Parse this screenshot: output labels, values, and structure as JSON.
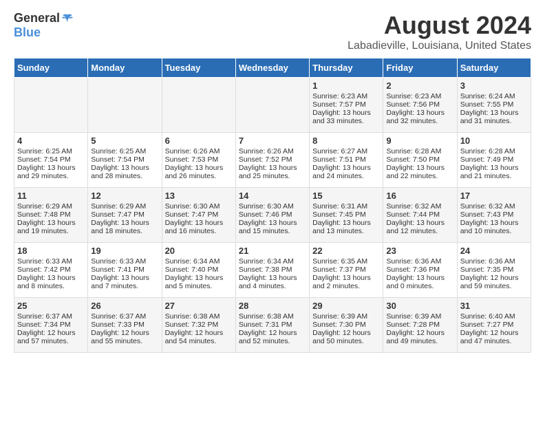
{
  "logo": {
    "general": "General",
    "blue": "Blue"
  },
  "title": "August 2024",
  "subtitle": "Labadieville, Louisiana, United States",
  "headers": [
    "Sunday",
    "Monday",
    "Tuesday",
    "Wednesday",
    "Thursday",
    "Friday",
    "Saturday"
  ],
  "weeks": [
    [
      {
        "day": "",
        "content": ""
      },
      {
        "day": "",
        "content": ""
      },
      {
        "day": "",
        "content": ""
      },
      {
        "day": "",
        "content": ""
      },
      {
        "day": "1",
        "content": "Sunrise: 6:23 AM\nSunset: 7:57 PM\nDaylight: 13 hours and 33 minutes."
      },
      {
        "day": "2",
        "content": "Sunrise: 6:23 AM\nSunset: 7:56 PM\nDaylight: 13 hours and 32 minutes."
      },
      {
        "day": "3",
        "content": "Sunrise: 6:24 AM\nSunset: 7:55 PM\nDaylight: 13 hours and 31 minutes."
      }
    ],
    [
      {
        "day": "4",
        "content": "Sunrise: 6:25 AM\nSunset: 7:54 PM\nDaylight: 13 hours and 29 minutes."
      },
      {
        "day": "5",
        "content": "Sunrise: 6:25 AM\nSunset: 7:54 PM\nDaylight: 13 hours and 28 minutes."
      },
      {
        "day": "6",
        "content": "Sunrise: 6:26 AM\nSunset: 7:53 PM\nDaylight: 13 hours and 26 minutes."
      },
      {
        "day": "7",
        "content": "Sunrise: 6:26 AM\nSunset: 7:52 PM\nDaylight: 13 hours and 25 minutes."
      },
      {
        "day": "8",
        "content": "Sunrise: 6:27 AM\nSunset: 7:51 PM\nDaylight: 13 hours and 24 minutes."
      },
      {
        "day": "9",
        "content": "Sunrise: 6:28 AM\nSunset: 7:50 PM\nDaylight: 13 hours and 22 minutes."
      },
      {
        "day": "10",
        "content": "Sunrise: 6:28 AM\nSunset: 7:49 PM\nDaylight: 13 hours and 21 minutes."
      }
    ],
    [
      {
        "day": "11",
        "content": "Sunrise: 6:29 AM\nSunset: 7:48 PM\nDaylight: 13 hours and 19 minutes."
      },
      {
        "day": "12",
        "content": "Sunrise: 6:29 AM\nSunset: 7:47 PM\nDaylight: 13 hours and 18 minutes."
      },
      {
        "day": "13",
        "content": "Sunrise: 6:30 AM\nSunset: 7:47 PM\nDaylight: 13 hours and 16 minutes."
      },
      {
        "day": "14",
        "content": "Sunrise: 6:30 AM\nSunset: 7:46 PM\nDaylight: 13 hours and 15 minutes."
      },
      {
        "day": "15",
        "content": "Sunrise: 6:31 AM\nSunset: 7:45 PM\nDaylight: 13 hours and 13 minutes."
      },
      {
        "day": "16",
        "content": "Sunrise: 6:32 AM\nSunset: 7:44 PM\nDaylight: 13 hours and 12 minutes."
      },
      {
        "day": "17",
        "content": "Sunrise: 6:32 AM\nSunset: 7:43 PM\nDaylight: 13 hours and 10 minutes."
      }
    ],
    [
      {
        "day": "18",
        "content": "Sunrise: 6:33 AM\nSunset: 7:42 PM\nDaylight: 13 hours and 8 minutes."
      },
      {
        "day": "19",
        "content": "Sunrise: 6:33 AM\nSunset: 7:41 PM\nDaylight: 13 hours and 7 minutes."
      },
      {
        "day": "20",
        "content": "Sunrise: 6:34 AM\nSunset: 7:40 PM\nDaylight: 13 hours and 5 minutes."
      },
      {
        "day": "21",
        "content": "Sunrise: 6:34 AM\nSunset: 7:38 PM\nDaylight: 13 hours and 4 minutes."
      },
      {
        "day": "22",
        "content": "Sunrise: 6:35 AM\nSunset: 7:37 PM\nDaylight: 13 hours and 2 minutes."
      },
      {
        "day": "23",
        "content": "Sunrise: 6:36 AM\nSunset: 7:36 PM\nDaylight: 13 hours and 0 minutes."
      },
      {
        "day": "24",
        "content": "Sunrise: 6:36 AM\nSunset: 7:35 PM\nDaylight: 12 hours and 59 minutes."
      }
    ],
    [
      {
        "day": "25",
        "content": "Sunrise: 6:37 AM\nSunset: 7:34 PM\nDaylight: 12 hours and 57 minutes."
      },
      {
        "day": "26",
        "content": "Sunrise: 6:37 AM\nSunset: 7:33 PM\nDaylight: 12 hours and 55 minutes."
      },
      {
        "day": "27",
        "content": "Sunrise: 6:38 AM\nSunset: 7:32 PM\nDaylight: 12 hours and 54 minutes."
      },
      {
        "day": "28",
        "content": "Sunrise: 6:38 AM\nSunset: 7:31 PM\nDaylight: 12 hours and 52 minutes."
      },
      {
        "day": "29",
        "content": "Sunrise: 6:39 AM\nSunset: 7:30 PM\nDaylight: 12 hours and 50 minutes."
      },
      {
        "day": "30",
        "content": "Sunrise: 6:39 AM\nSunset: 7:28 PM\nDaylight: 12 hours and 49 minutes."
      },
      {
        "day": "31",
        "content": "Sunrise: 6:40 AM\nSunset: 7:27 PM\nDaylight: 12 hours and 47 minutes."
      }
    ]
  ]
}
